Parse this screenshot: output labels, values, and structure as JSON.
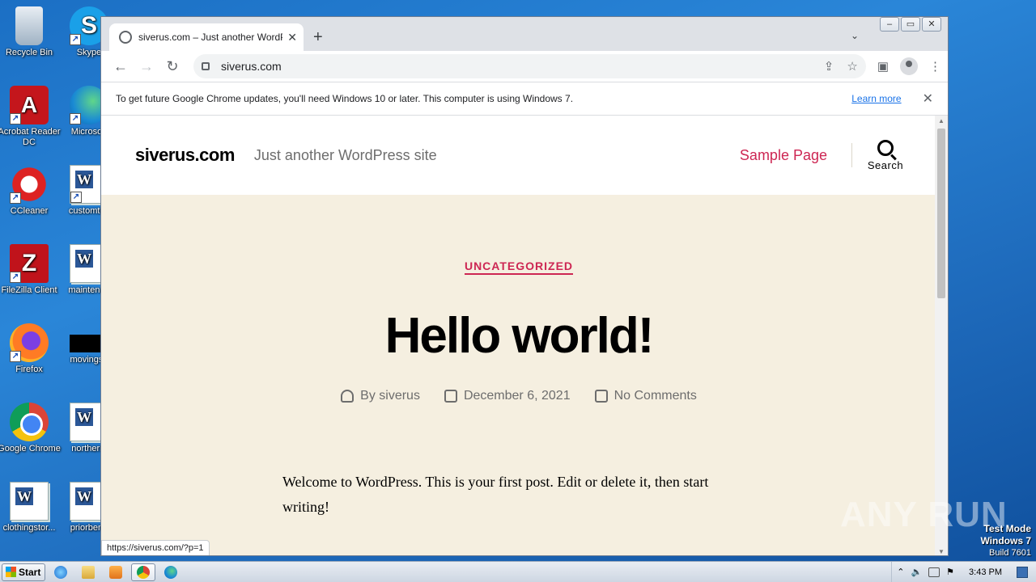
{
  "desktop": {
    "icons": [
      {
        "label": "Recycle Bin"
      },
      {
        "label": "Skype"
      },
      {
        "label": "Acrobat Reader DC"
      },
      {
        "label": "Microsoft"
      },
      {
        "label": "CCleaner"
      },
      {
        "label": "customtes"
      },
      {
        "label": "FileZilla Client"
      },
      {
        "label": "maintenan"
      },
      {
        "label": "Firefox"
      },
      {
        "label": "movingsu"
      },
      {
        "label": "Google Chrome"
      },
      {
        "label": "northernl"
      },
      {
        "label": "clothingstor..."
      },
      {
        "label": "priorbene"
      }
    ]
  },
  "browser": {
    "tab_title": "siverus.com – Just another WordPre",
    "new_tab": "+",
    "url": "siverus.com",
    "infobar_message": "To get future Google Chrome updates, you'll need Windows 10 or later. This computer is using Windows 7.",
    "infobar_link": "Learn more",
    "status_url": "https://siverus.com/?p=1"
  },
  "site": {
    "title": "siverus.com",
    "description": "Just another WordPress site",
    "menu_item": "Sample Page",
    "search_label": "Search",
    "post": {
      "category": "UNCATEGORIZED",
      "title": "Hello world!",
      "author": "By siverus",
      "date": "December 6, 2021",
      "comments": "No Comments",
      "body": "Welcome to WordPress. This is your first post. Edit or delete it, then start writing!"
    }
  },
  "watermark": "ANY RUN",
  "system": {
    "test_mode_line1": "Test Mode",
    "test_mode_line2": "Windows 7",
    "test_mode_line3": "Build 7601",
    "start_label": "Start",
    "clock": "3:43 PM"
  },
  "colors": {
    "accent": "#cd2653",
    "page_bg": "#f5efe0",
    "desktop_bg": "#1b6fc4"
  }
}
